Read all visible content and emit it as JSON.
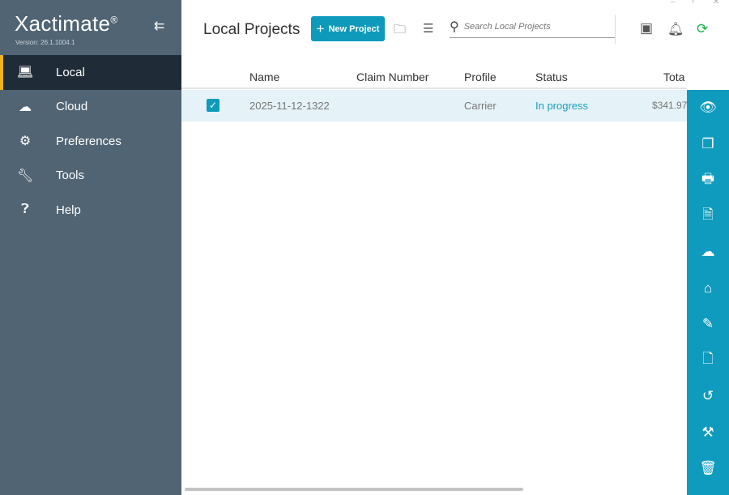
{
  "app": {
    "name": "Xactimate",
    "registered": "®",
    "version": "Version: 26.1.1004.1"
  },
  "sidebar": {
    "items": [
      {
        "label": "Local",
        "icon": "laptop-icon"
      },
      {
        "label": "Cloud",
        "icon": "cloud-icon"
      },
      {
        "label": "Preferences",
        "icon": "gear-icon"
      },
      {
        "label": "Tools",
        "icon": "wrench-icon"
      },
      {
        "label": "Help",
        "icon": "help-icon"
      }
    ]
  },
  "header": {
    "title": "Local Projects",
    "new_project": "New Project",
    "search_placeholder": "Search Local Projects"
  },
  "table": {
    "columns": [
      "Name",
      "Claim Number",
      "Profile",
      "Status",
      "Tota"
    ],
    "rows": [
      {
        "name": "2025-11-12-1322",
        "claim": "",
        "profile": "Carrier",
        "status": "In progress",
        "total": "$341.97"
      }
    ]
  },
  "colors": {
    "accent": "#0d9abb",
    "sidebar": "#506474",
    "active": "#1f2b36",
    "highlight": "#f3b21b"
  }
}
